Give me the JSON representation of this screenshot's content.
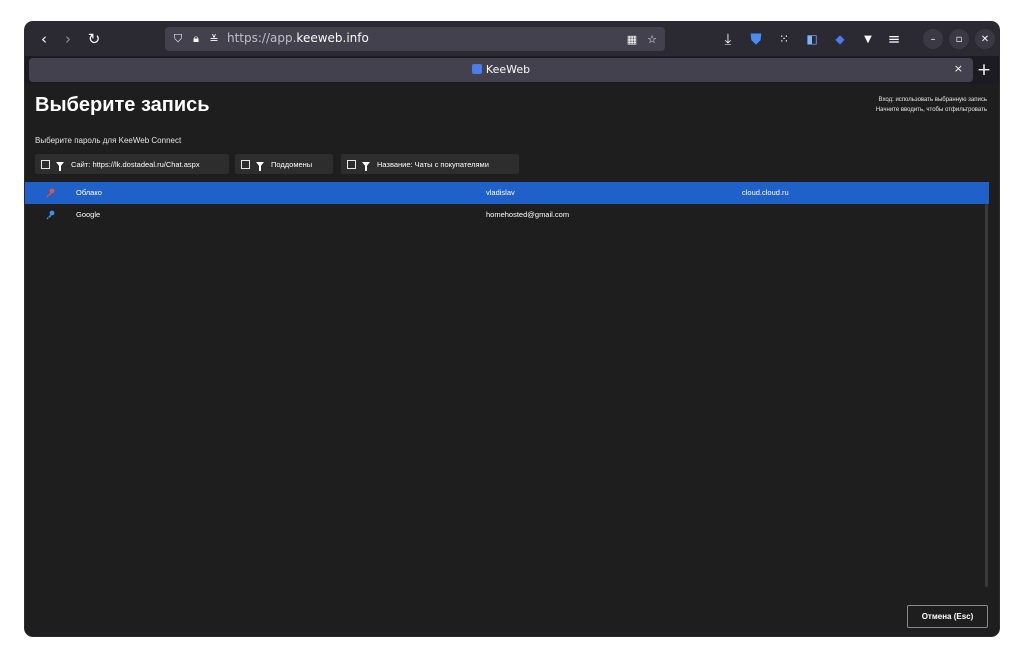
{
  "browser": {
    "url_prefix": "https://app.",
    "url_domain": "keeweb.info",
    "tab_title": "KeeWeb",
    "tab_close": "×",
    "new_tab": "+"
  },
  "page": {
    "title": "Выберите запись",
    "hint_line1": "Вход: использовать выбранную запись",
    "hint_line2": "Начните вводить, чтобы отфильтровать",
    "subtitle": "Выберите пароль для KeeWeb Connect"
  },
  "filters": [
    {
      "label": "Сайт: https://lk.dostadeal.ru/Chat.aspx"
    },
    {
      "label": "Поддомены"
    },
    {
      "label": "Название: Чаты с покупателями"
    }
  ],
  "entries": [
    {
      "title": "Облако",
      "user": "vladislav",
      "url": "cloud.cloud.ru",
      "icon_color": "#e8523e"
    },
    {
      "title": "Google",
      "user": "homehosted@gmail.com",
      "url": "",
      "icon_color": "#3f8df0"
    }
  ],
  "buttons": {
    "cancel": "Отмена (Esc)"
  },
  "colors": {
    "selection": "#1f61c9",
    "background": "#1e1e1e"
  }
}
